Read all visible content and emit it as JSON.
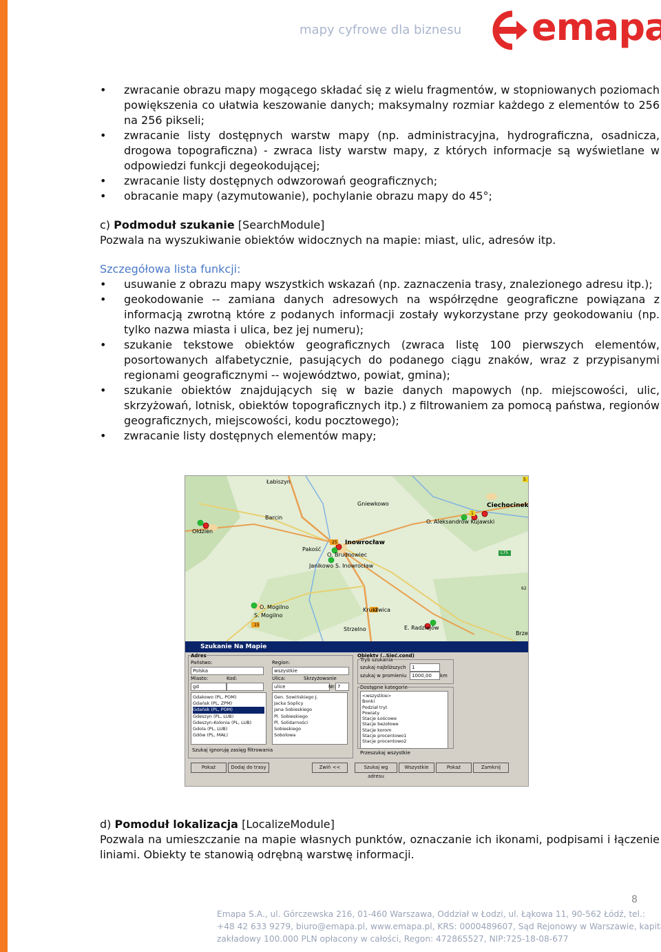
{
  "header": {
    "tagline": "mapy cyfrowe dla biznesu",
    "logo_text": "emapa",
    "brand_color": "#e32a2a",
    "accent_color": "#f47920"
  },
  "bullets_a": [
    "zwracanie obrazu mapy mogącego składać się z wielu fragmentów, w stopniowanych poziomach powiększenia co ułatwia keszowanie danych; maksymalny rozmiar każdego z elementów to 256 na 256 pikseli;",
    "zwracanie listy dostępnych warstw mapy (np. administracyjna, hydrograficzna, osadnicza, drogowa topograficzna) - zwraca listy warstw mapy, z których informacje są wyświetlane w odpowiedzi funkcji degeokodującej;",
    "zwracanie listy dostępnych odwzorowań geograficznych;",
    "obracanie mapy (azymutowanie), pochylanie obrazu mapy do 45°;"
  ],
  "section_c": {
    "prefix": "c) ",
    "name": "Podmoduł szukanie",
    "suffix": " [SearchModule]",
    "description": "Pozwala na wyszukiwanie obiektów widocznych na mapie: miast, ulic, adresów itp."
  },
  "detail_heading": "Szczegółowa lista funkcji:",
  "bullets_b": [
    "usuwanie z obrazu mapy wszystkich wskazań (np. zaznaczenia trasy, znalezionego adresu itp.);",
    "geokodowanie -- zamiana danych adresowych na współrzędne geograficzne powiązana z informacją zwrotną które z podanych informacji zostały wykorzystane przy geokodowaniu (np. tylko nazwa miasta i ulica, bez jej numeru);",
    "szukanie tekstowe obiektów geograficznych (zwraca listę 100 pierwszych elementów, posortowanych alfabetycznie, pasujących do podanego ciągu znaków, wraz z przypisanymi regionami geograficznymi -- województwo, powiat, gmina);",
    "szukanie obiektów znajdujących się w bazie danych mapowych (np. miejscowości, ulic, skrzyżowań, lotnisk, obiektów topograficznych itp.) z filtrowaniem za pomocą państwa, regionów geograficznych, miejscowości, kodu pocztowego);",
    "zwracanie listy dostępnych elementów mapy;"
  ],
  "map": {
    "labels": [
      "Łabiszyn",
      "Gniewkowo",
      "Ciechocinek",
      "Barcin",
      "O. Aleksandrów Kujawski",
      "Ołdzien",
      "Inowrocław",
      "Pakość",
      "O. Brudnowiec",
      "Janikowo",
      "S. Inowrocław",
      "O. Mogilno",
      "S. Mogilno",
      "Kruszwica",
      "Strzelno",
      "E. Radziejów",
      "Brze",
      "L75"
    ],
    "road_numbers": [
      "5",
      "25",
      "15",
      "1",
      "15",
      "62"
    ]
  },
  "dialog": {
    "title": "Szukanie Na Mapie",
    "adres": "Adres",
    "panstwo": "Państwo:",
    "panstwo_value": "Polska",
    "region": "Region:",
    "region_value": "wszystkie",
    "miasto": "Miasto:",
    "kod": "Kod:",
    "miasto_value": "gd",
    "ulica": "Ulica:",
    "ulica_value": "ulice",
    "obiekt": "Obiekt:",
    "skrzyzowanie": "Skrzyżowanie",
    "nr": "Nr:",
    "nr_value": "7",
    "obiekt_value": "so",
    "cities": [
      "Gdakowo (PL, POM)",
      "Gdańsk (PL, ZPM)",
      "Gdańsk (PL, POM)",
      "Gdeszyn (PL, LUB)",
      "Gdeszyn-Kolonia (PL, LUB)",
      "Gdola (PL, LUB)",
      "Gdów (PL, MAŁ)"
    ],
    "streets": [
      "Gen. Sowińskiego J.",
      "Jacka Soplicy",
      "Jana Sobieskiego",
      "Pl. Sobieskiego",
      "Pl. Solidarności",
      "Sobieskiego",
      "Sobolowa",
      "Sobótki"
    ],
    "objects_header": "Obiekty (..Sieć.cond)",
    "tryb": "Tryb szukania",
    "tryb_opt1": "szukaj najbliższych",
    "tryb_val1": "1",
    "tryb_opt2": "szukaj w promieniu",
    "tryb_val2": "1000,00",
    "unit": "km",
    "kategorie": "Dostępne kategorie",
    "categories": [
      "<wszystkie>",
      "Bonki",
      "Podział tryt",
      "Powiaty",
      "Stacje Łoścowe",
      "Stacje bezołowe",
      "Stacje korom",
      "Stacje procentowo1",
      "Stacje procentowo2"
    ],
    "ignore": "Szukaj ignoruję zasięg filtrowania",
    "przeszukaj": "Przeszukaj wszystkie",
    "btn_pokaz": "Pokaż",
    "btn_dodaj": "Dodaj do trasy",
    "btn_zwin": "Zwiń <<",
    "btn_szukaj": "Szukaj wg adresu",
    "btn_wszystkie": "Wszystkie",
    "btn_pokaz2": "Pokaż",
    "btn_zamknij": "Zamknij"
  },
  "section_d": {
    "prefix": "d) ",
    "name": "Pomoduł lokalizacja",
    "suffix": " [LocalizeModule]",
    "description": "Pozwala na umieszczanie na mapie własnych punktów, oznaczanie ich ikonami, podpisami i łączenie liniami. Obiekty te stanowią odrębną warstwę informacji."
  },
  "footer": {
    "page_number": "8",
    "line1": "Emapa S.A., ul. Górczewska 216, 01-460 Warszawa, Oddział w Łodzi, ul. Łąkowa 11, 90-562 Łódź, tel.:",
    "line2": "+48 42 633 9279, biuro@emapa.pl, www.emapa.pl, KRS: 0000489607, Sąd Rejonowy w Warszawie, kapitał",
    "line3": "zakładowy 100.000 PLN opłacony w całości, Regon: 472865527, NIP:725-18-08-677"
  }
}
